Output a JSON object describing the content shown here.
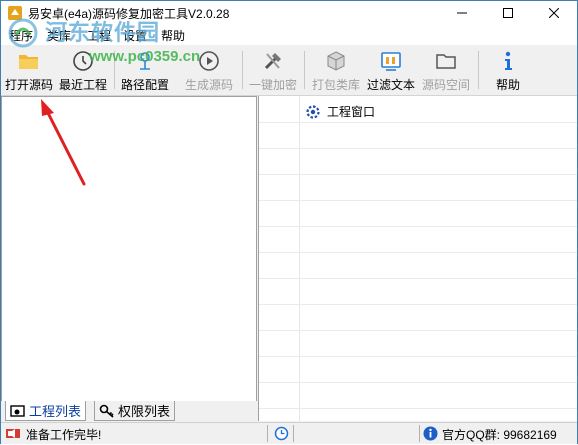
{
  "window": {
    "title": "易安卓(e4a)源码修复加密工具V2.0.28",
    "controls": [
      "minimize",
      "maximize",
      "close"
    ]
  },
  "menu": {
    "items": [
      "程序",
      "类库",
      "工程",
      "设置",
      "帮助"
    ]
  },
  "watermark": {
    "site_name": "河东软件园",
    "url": "www.pc0359.cn"
  },
  "toolbar": {
    "buttons": [
      {
        "label": "打开源码",
        "icon": "folder-open-icon",
        "enabled": true
      },
      {
        "label": "最近工程",
        "icon": "recent-icon",
        "enabled": true
      },
      {
        "label": "路径配置",
        "icon": "path-config-icon",
        "enabled": true
      },
      {
        "label": "生成源码",
        "icon": "play-icon",
        "enabled": false
      },
      {
        "label": "一键加密",
        "icon": "tools-icon",
        "enabled": false
      },
      {
        "label": "打包类库",
        "icon": "package-icon",
        "enabled": false
      },
      {
        "label": "过滤文本",
        "icon": "filter-text-icon",
        "enabled": true
      },
      {
        "label": "源码空间",
        "icon": "folder-icon",
        "enabled": false
      },
      {
        "label": "帮助",
        "icon": "info-icon",
        "enabled": true
      }
    ]
  },
  "right_panel": {
    "node_label": "工程窗口"
  },
  "tabs": {
    "items": [
      "工程列表",
      "权限列表"
    ],
    "active": "工程列表"
  },
  "status": {
    "message": "准备工作完毕!",
    "qq_group": "官方QQ群: 99682169"
  },
  "colors": {
    "accent": "#1e6fd9",
    "arrow": "#e02020",
    "watermark_blue": "#5aa9d8",
    "watermark_green": "#3cb24a"
  }
}
